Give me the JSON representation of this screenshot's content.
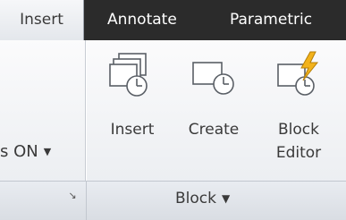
{
  "ribbon": {
    "tabs": [
      {
        "label": "Insert",
        "active": true
      },
      {
        "label": "Annotate",
        "active": false
      },
      {
        "label": "Parametric",
        "active": false
      }
    ]
  },
  "left_panel": {
    "control_label": "s ON",
    "control_icon": "chevron-down-icon",
    "launcher_icon": "dialog-launcher-icon"
  },
  "block_panel": {
    "title": "Block",
    "title_icon": "chevron-down-icon",
    "tools": [
      {
        "label": "Insert",
        "icon": "insert-block-icon"
      },
      {
        "label": "Create",
        "icon": "create-block-icon"
      },
      {
        "label": "Block\nEditor",
        "icon": "block-editor-icon"
      }
    ]
  },
  "colors": {
    "tabbar_bg": "#2b2b2b",
    "active_tab_bg": "#eef0f3",
    "panel_bg": "#f3f4f6",
    "footer_bg": "#dfe2e7",
    "lightning_yellow": "#f2b21b",
    "text": "#3a3a3a"
  }
}
